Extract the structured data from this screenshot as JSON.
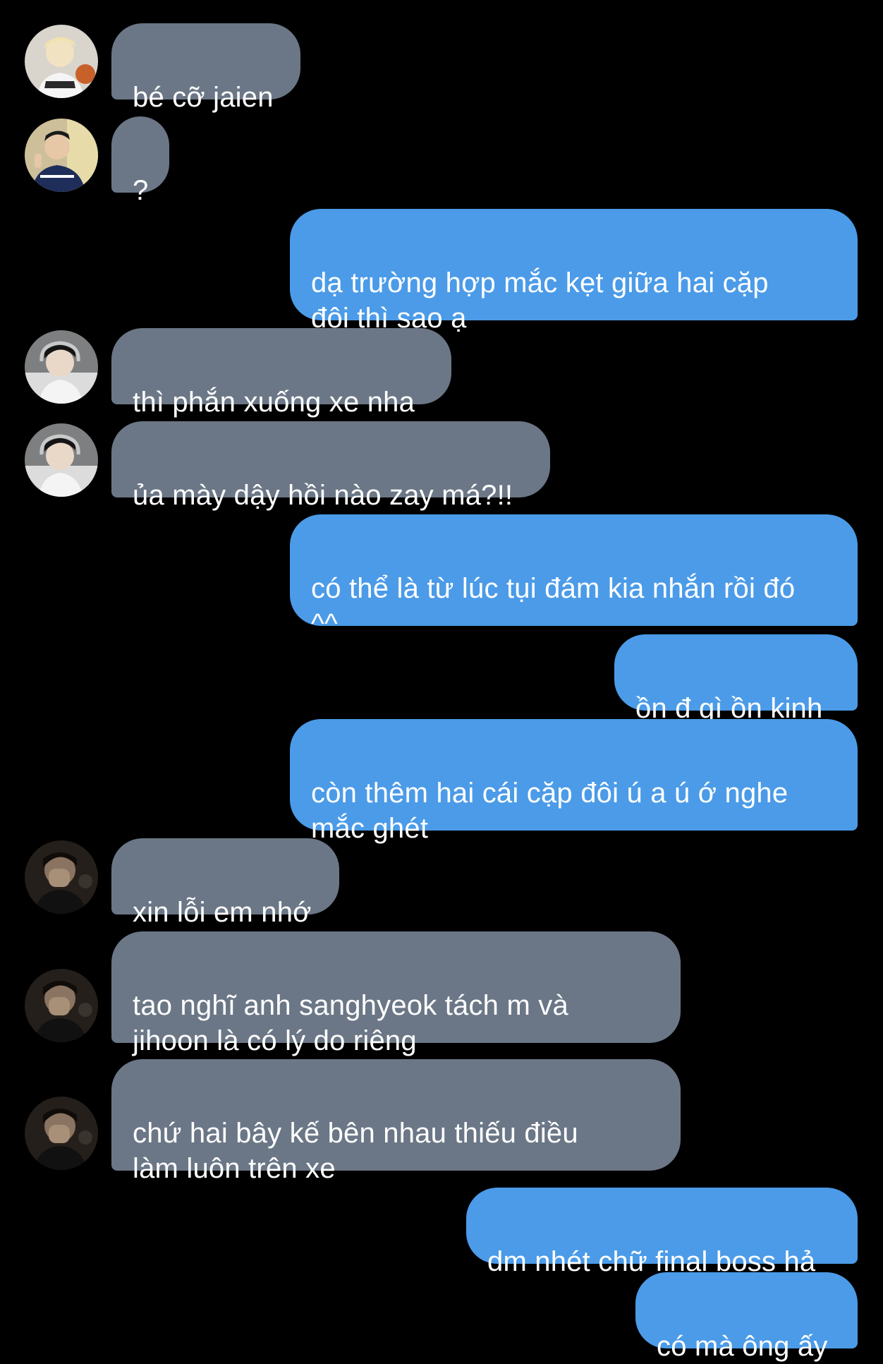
{
  "colors": {
    "background": "#000000",
    "incoming_bubble": "#6b7786",
    "outgoing_bubble": "#4b9be8",
    "text": "#ffffff"
  },
  "messages": [
    {
      "side": "in",
      "avatar": "avatar-photo-1",
      "text": "bé cỡ jaien"
    },
    {
      "side": "in",
      "avatar": "avatar-photo-2",
      "text": "?"
    },
    {
      "side": "out",
      "text": "dạ trường hợp mắc kẹt giữa hai cặp\nđôi thì sao ạ"
    },
    {
      "side": "in",
      "avatar": "avatar-photo-3",
      "text": "thì phắn xuống xe nha"
    },
    {
      "side": "in",
      "avatar": "avatar-photo-3",
      "text": "ủa mày dậy hồi nào zay má?!!"
    },
    {
      "side": "out",
      "text": "có thể là từ lúc tụi đám kia nhắn rồi đó\n^^"
    },
    {
      "side": "out",
      "text": "ồn đ gì ồn kinh"
    },
    {
      "side": "out",
      "text": "còn thêm hai cái cặp đôi ú a ú ớ nghe\nmắc ghét"
    },
    {
      "side": "in",
      "avatar": "avatar-photo-4",
      "text": "xin lỗi em nhớ"
    },
    {
      "side": "in",
      "avatar": "avatar-photo-4",
      "text": "tao nghĩ anh sanghyeok tách m và\njihoon là có lý do riêng"
    },
    {
      "side": "in",
      "avatar": "avatar-photo-4",
      "text": "chứ hai bây kế bên nhau thiếu điều\nlàm luôn trên xe"
    },
    {
      "side": "out",
      "text": "dm nhét chữ final boss hả"
    },
    {
      "side": "out",
      "text": "có mà ông ấy"
    }
  ]
}
